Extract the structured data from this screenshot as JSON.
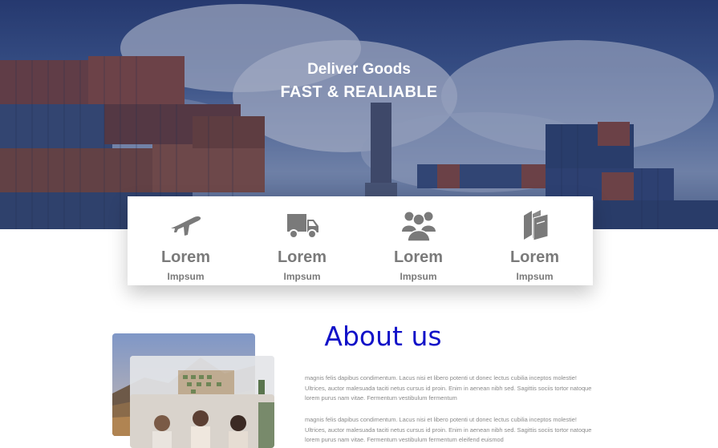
{
  "hero": {
    "subtitle": "Deliver Goods",
    "title": "FAST & REALIABLE"
  },
  "features": [
    {
      "icon": "airplane-icon",
      "title": "Lorem",
      "subtitle": "Impsum"
    },
    {
      "icon": "truck-icon",
      "title": "Lorem",
      "subtitle": "Impsum"
    },
    {
      "icon": "users-icon",
      "title": "Lorem",
      "subtitle": "Impsum"
    },
    {
      "icon": "books-icon",
      "title": "Lorem",
      "subtitle": "Impsum"
    }
  ],
  "about": {
    "title": "About us",
    "paragraphs": [
      "magnis felis dapibus condimentum. Lacus nisi et libero potenti ut donec lectus cubilia inceptos molestie! Ultrices, auctor malesuada taciti netus cursus id proin. Enim in aenean nibh sed. Sagittis sociis tortor natoque lorem purus nam vitae. Fermentum vestibulum fermentum",
      "magnis felis dapibus condimentum. Lacus nisi et libero potenti ut donec lectus cubilia inceptos molestie! Ultrices, auctor malesuada taciti netus cursus id proin. Enim in aenean nibh sed. Sagittis sociis tortor natoque lorem purus nam vitae. Fermentum vestibulum fermentum eleifend euismod"
    ]
  },
  "colors": {
    "about_title": "#1212c8",
    "feature_text": "#7a7a7a",
    "hero_overlay": "#2a3f78"
  }
}
